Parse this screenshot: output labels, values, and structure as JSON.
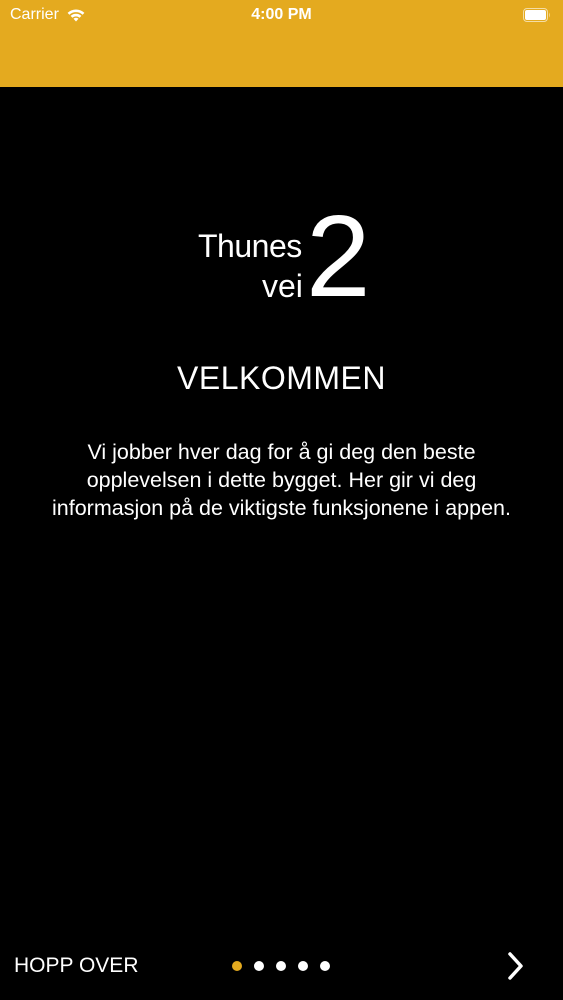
{
  "status_bar": {
    "carrier": "Carrier",
    "time": "4:00 PM",
    "color": "#E4AA1F"
  },
  "logo": {
    "line1": "Thunes",
    "line2": "vei",
    "number": "2"
  },
  "onboarding": {
    "title": "VELKOMMEN",
    "body": "Vi jobber hver dag for å gi deg den beste opplevelsen i dette bygget. Her gir vi deg informasjon på de viktigste funksjonene i appen."
  },
  "navigation": {
    "skip_label": "HOPP OVER",
    "page_count": 5,
    "active_page": 1,
    "next_icon": "chevron-right-icon"
  }
}
